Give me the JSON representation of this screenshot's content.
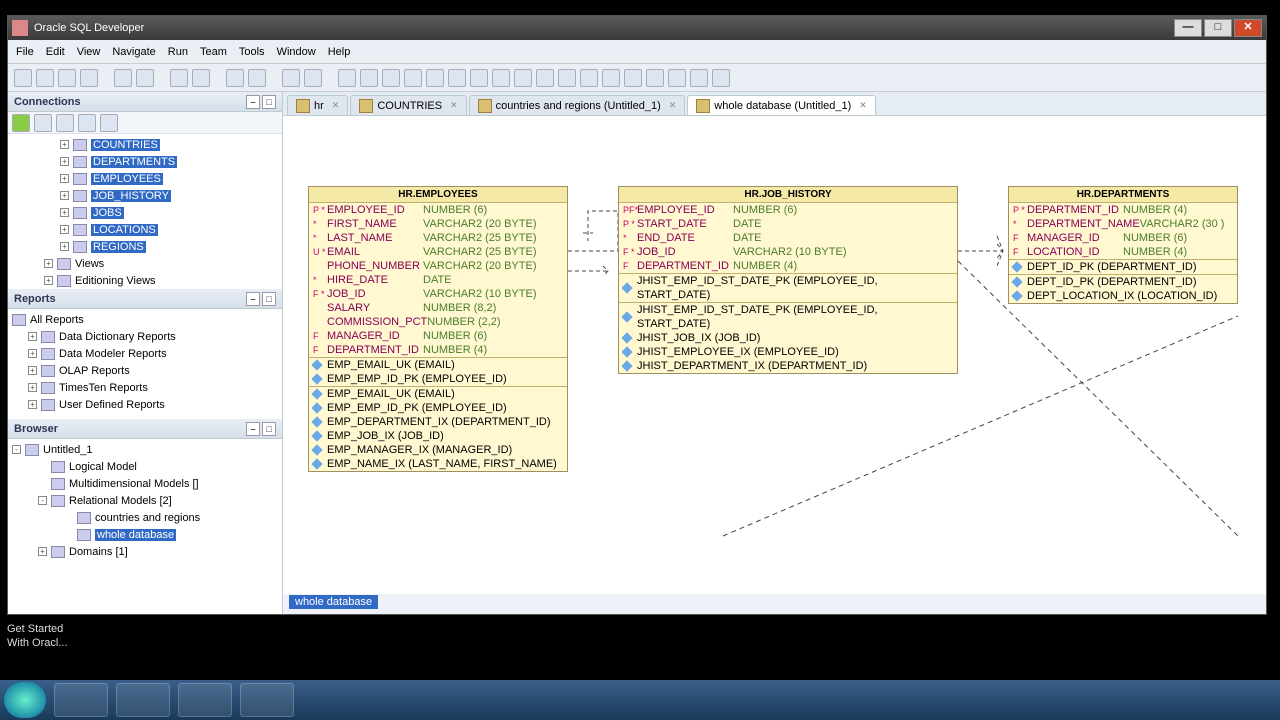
{
  "title": "Oracle SQL Developer",
  "menu": [
    "File",
    "Edit",
    "View",
    "Navigate",
    "Run",
    "Team",
    "Tools",
    "Window",
    "Help"
  ],
  "panels": {
    "connections": "Connections",
    "reports": "Reports",
    "browser": "Browser"
  },
  "connTree": [
    "COUNTRIES",
    "DEPARTMENTS",
    "EMPLOYEES",
    "JOB_HISTORY",
    "JOBS",
    "LOCATIONS",
    "REGIONS"
  ],
  "connExtra": [
    "Views",
    "Editioning Views"
  ],
  "reportsTree": [
    "All Reports",
    "Data Dictionary Reports",
    "Data Modeler Reports",
    "OLAP Reports",
    "TimesTen Reports",
    "User Defined Reports"
  ],
  "browserTree": {
    "root": "Untitled_1",
    "items": [
      "Logical Model",
      "Multidimensional Models []",
      "Relational Models [2]"
    ],
    "rel": [
      "countries and regions",
      "whole database"
    ],
    "domains": "Domains [1]"
  },
  "tabs": [
    {
      "label": "hr"
    },
    {
      "label": "COUNTRIES"
    },
    {
      "label": "countries and regions (Untitled_1)"
    },
    {
      "label": "whole database (Untitled_1)",
      "active": true
    }
  ],
  "bottab": "whole database",
  "status": [
    "Get Started",
    "With Oracl..."
  ],
  "entities": {
    "emp": {
      "title": "HR.EMPLOYEES",
      "cols": [
        {
          "f": "P *",
          "n": "EMPLOYEE_ID",
          "t": "NUMBER (6)"
        },
        {
          "f": "*",
          "n": "FIRST_NAME",
          "t": "VARCHAR2 (20 BYTE)"
        },
        {
          "f": "*",
          "n": "LAST_NAME",
          "t": "VARCHAR2 (25 BYTE)"
        },
        {
          "f": "U *",
          "n": "EMAIL",
          "t": "VARCHAR2 (25 BYTE)"
        },
        {
          "f": "",
          "n": "PHONE_NUMBER",
          "t": "VARCHAR2 (20 BYTE)"
        },
        {
          "f": "*",
          "n": "HIRE_DATE",
          "t": "DATE"
        },
        {
          "f": "F *",
          "n": "JOB_ID",
          "t": "VARCHAR2 (10 BYTE)"
        },
        {
          "f": "",
          "n": "SALARY",
          "t": "NUMBER (8,2)"
        },
        {
          "f": "",
          "n": "COMMISSION_PCT",
          "t": "NUMBER (2,2)"
        },
        {
          "f": "F",
          "n": "MANAGER_ID",
          "t": "NUMBER (6)"
        },
        {
          "f": "F",
          "n": "DEPARTMENT_ID",
          "t": "NUMBER (4)"
        }
      ],
      "idx1": [
        "EMP_EMAIL_UK (EMAIL)",
        "EMP_EMP_ID_PK (EMPLOYEE_ID)"
      ],
      "idx2": [
        "EMP_EMAIL_UK (EMAIL)",
        "EMP_EMP_ID_PK (EMPLOYEE_ID)",
        "EMP_DEPARTMENT_IX (DEPARTMENT_ID)",
        "EMP_JOB_IX (JOB_ID)",
        "EMP_MANAGER_IX (MANAGER_ID)",
        "EMP_NAME_IX (LAST_NAME, FIRST_NAME)"
      ]
    },
    "jh": {
      "title": "HR.JOB_HISTORY",
      "cols": [
        {
          "f": "PF*",
          "n": "EMPLOYEE_ID",
          "t": "NUMBER (6)"
        },
        {
          "f": "P *",
          "n": "START_DATE",
          "t": "DATE"
        },
        {
          "f": "*",
          "n": "END_DATE",
          "t": "DATE"
        },
        {
          "f": "F *",
          "n": "JOB_ID",
          "t": "VARCHAR2 (10 BYTE)"
        },
        {
          "f": "F",
          "n": "DEPARTMENT_ID",
          "t": "NUMBER (4)"
        }
      ],
      "idx1": [
        "JHIST_EMP_ID_ST_DATE_PK (EMPLOYEE_ID, START_DATE)"
      ],
      "idx2": [
        "JHIST_EMP_ID_ST_DATE_PK (EMPLOYEE_ID, START_DATE)",
        "JHIST_JOB_IX (JOB_ID)",
        "JHIST_EMPLOYEE_IX (EMPLOYEE_ID)",
        "JHIST_DEPARTMENT_IX (DEPARTMENT_ID)"
      ]
    },
    "dep": {
      "title": "HR.DEPARTMENTS",
      "cols": [
        {
          "f": "P *",
          "n": "DEPARTMENT_ID",
          "t": "NUMBER (4)"
        },
        {
          "f": "*",
          "n": "DEPARTMENT_NAME",
          "t": "VARCHAR2 (30 )"
        },
        {
          "f": "F",
          "n": "MANAGER_ID",
          "t": "NUMBER (6)"
        },
        {
          "f": "F",
          "n": "LOCATION_ID",
          "t": "NUMBER (4)"
        }
      ],
      "idx1": [
        "DEPT_ID_PK (DEPARTMENT_ID)"
      ],
      "idx2": [
        "DEPT_ID_PK (DEPARTMENT_ID)",
        "DEPT_LOCATION_IX (LOCATION_ID)"
      ]
    }
  }
}
